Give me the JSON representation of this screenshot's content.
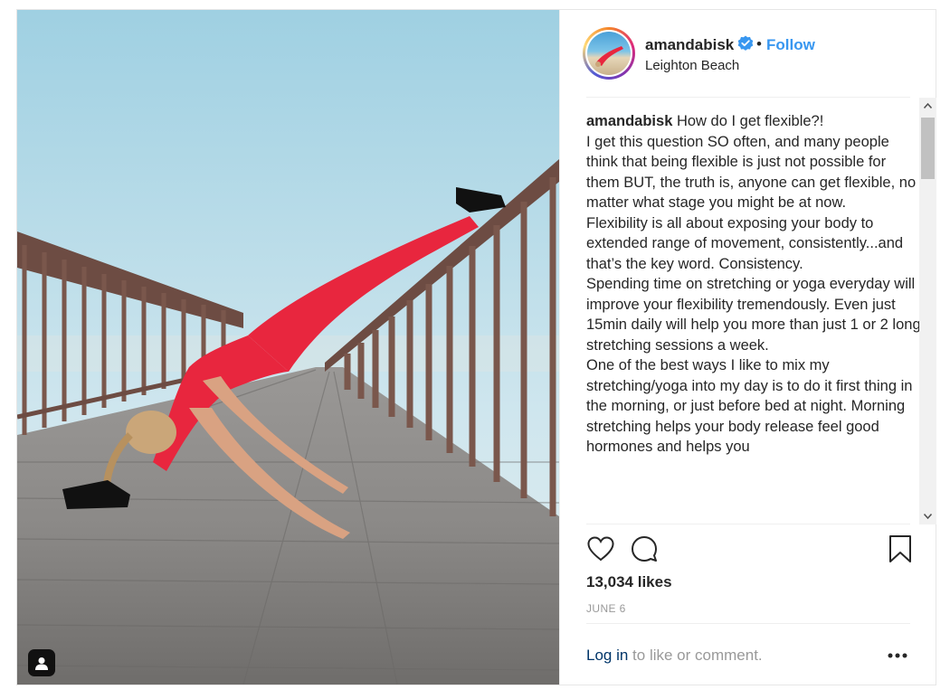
{
  "header": {
    "username": "amandabisk",
    "verified_icon": "verified-badge-icon",
    "separator": "•",
    "follow_label": "Follow",
    "location": "Leighton Beach"
  },
  "caption": {
    "username": "amandabisk",
    "text": " How do I get flexible?!\nI get this question SO often, and many people think that being flexible is just not possible for them BUT, the truth is, anyone can get flexible, no matter what stage you might be at now.\nFlexibility is all about exposing your body to extended range of movement, consistently...and that’s the key word. Consistency.\nSpending time on stretching or yoga everyday will improve your flexibility tremendously. Even just 15min daily will help you more than just 1 or 2 long stretching sessions a week.\nOne of the best ways I like to mix my stretching/yoga into my day is to do it first thing in the morning, or just before bed at night. Morning stretching helps your body release feel good hormones and helps you"
  },
  "actions": {
    "like_icon": "heart-icon",
    "comment_icon": "comment-icon",
    "save_icon": "bookmark-icon"
  },
  "likes": "13,034 likes",
  "date": "JUNE 6",
  "footer": {
    "login_label": "Log in",
    "login_suffix": " to like or comment.",
    "more_icon": "more-options-icon"
  },
  "colors": {
    "accent": "#3897f0",
    "text": "#262626",
    "muted": "#999999",
    "link": "#003569",
    "outfit": "#e8263e"
  }
}
